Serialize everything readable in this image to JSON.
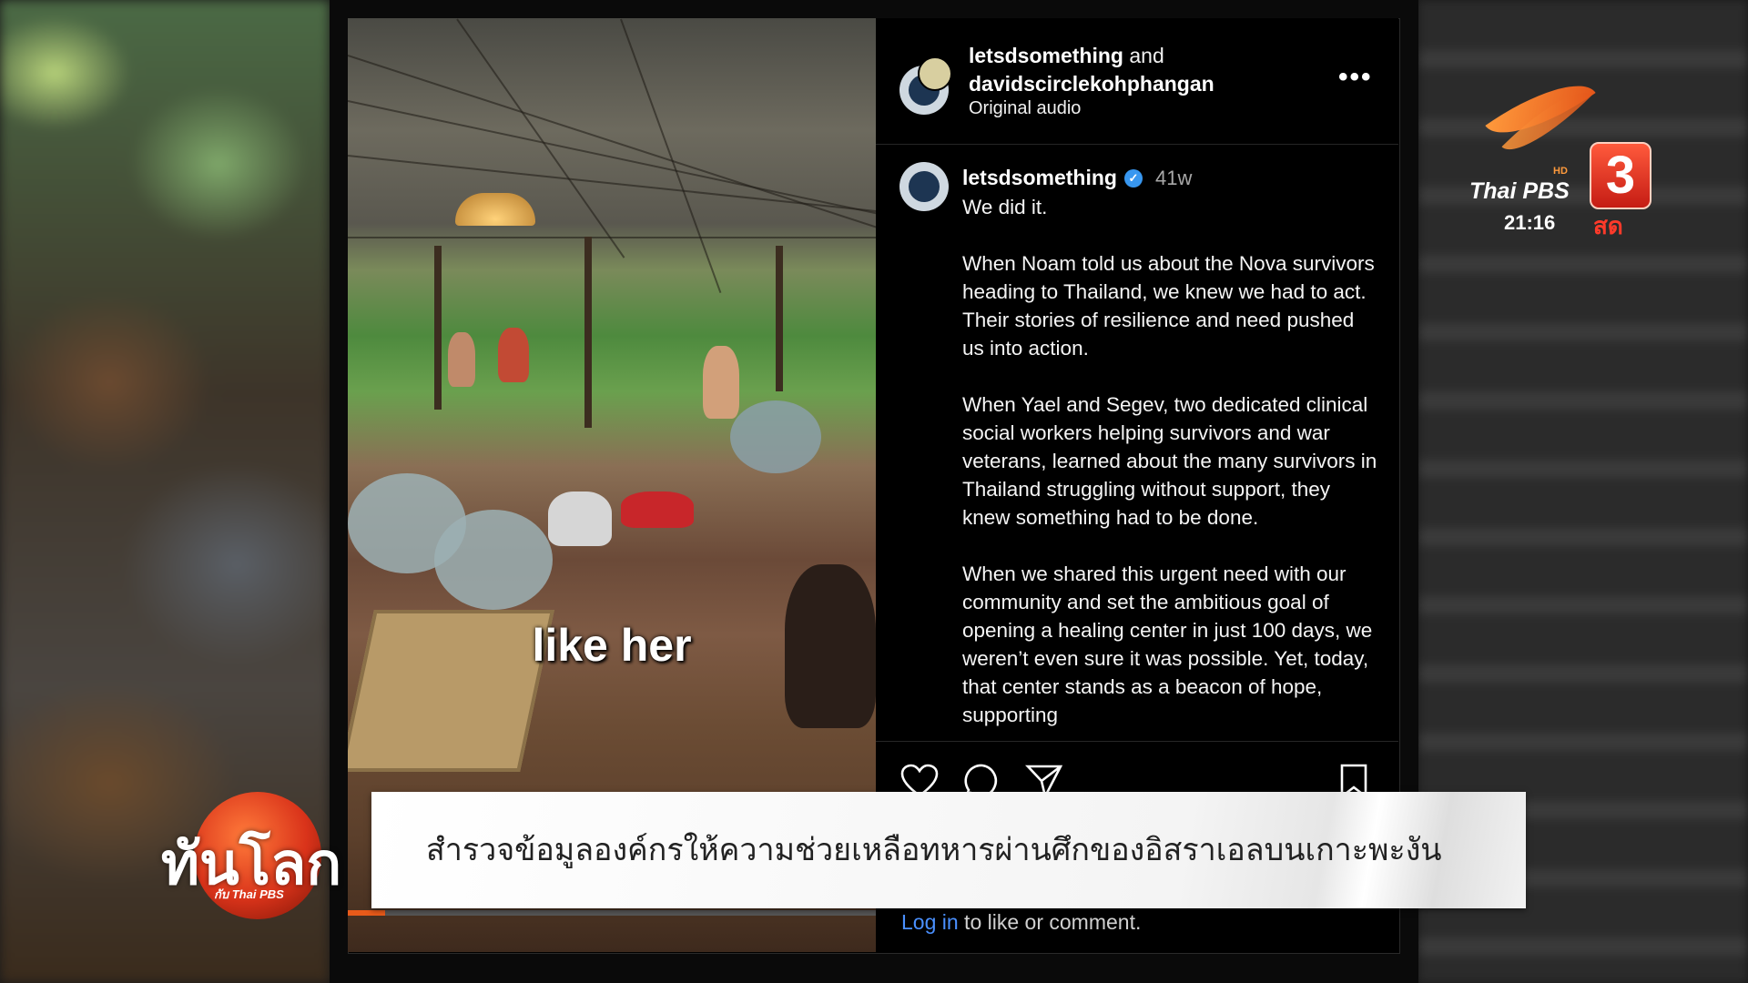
{
  "post": {
    "header_user1": "letsdsomething",
    "header_and": "and",
    "header_user2": "davidscirclekohphangan",
    "audio_label": "Original audio",
    "more_label": "•••",
    "caption_user": "letsdsomething",
    "caption_age": "41w",
    "caption_text": "We did it.\n\nWhen Noam told us about the Nova survivors heading to Thailand, we knew we had to act. Their stories of resilience and need pushed us into action.\n\nWhen Yael and Segev, two dedicated clinical social workers helping survivors and war veterans, learned about the many survivors in Thailand struggling without support, they knew something had to be done.\n\nWhen we shared this urgent need with our community and set the ambitious goal of opening a healing center in just 100 days, we weren’t even sure it was possible. Yet, today, that center stands as a beacon of hope, supporting",
    "login_link": "Log in",
    "login_rest": " to like or comment.",
    "video_caption": "like her",
    "video_progress": 0.07
  },
  "broadcast": {
    "headline": "สำรวจข้อมูลองค์กรให้ความช่วยเหลือทหารผ่านศึกของอิสราเอลบนเกาะพะงัน",
    "show_title": "ทันโลก",
    "show_sub": "กับ Thai PBS",
    "channel_name": "Thai PBS",
    "channel_hd": "HD",
    "channel_number": "3",
    "time": "21:16",
    "live_label": "สด"
  },
  "colors": {
    "accent_blue": "#3897f0",
    "link_blue": "#4a90ff",
    "channel_orange": "#e4561a",
    "channel_red": "#c51c14"
  },
  "icons": [
    "heart-icon",
    "comment-icon",
    "share-icon",
    "bookmark-icon",
    "verified-icon",
    "more-icon",
    "mute-icon"
  ]
}
